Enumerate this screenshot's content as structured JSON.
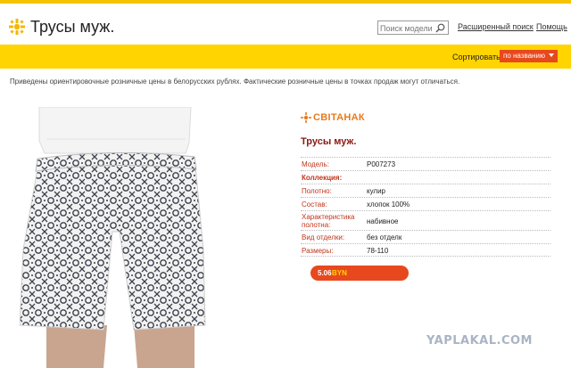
{
  "header": {
    "title": "Трусы муж.",
    "search_placeholder": "Поиск модели",
    "advanced_search_label": "Расширенный поиск",
    "help_label": "Помощь"
  },
  "sortbar": {
    "label": "Сортировать",
    "selected": "по названию"
  },
  "notice": "Приведены ориентировочные розничные цены в белорусских рублях. Фактические розничные цены в точках продаж могут отличаться.",
  "product": {
    "brand": "СВІТАНАК",
    "name": "Трусы муж.",
    "specs": [
      {
        "label": "Модель:",
        "value": "Р007273"
      },
      {
        "label": "Коллекция:",
        "value": ""
      },
      {
        "label": "Полотно:",
        "value": "кулир"
      },
      {
        "label": "Состав:",
        "value": "хлопок 100%"
      },
      {
        "label": "Характеристика полотна:",
        "value": "набивное"
      },
      {
        "label": "Вид отделки:",
        "value": "без отделк"
      },
      {
        "label": "Размеры:",
        "value": "78-110"
      }
    ],
    "price": {
      "value": "5.06",
      "currency": "BYN"
    }
  },
  "watermark": "YAPLAKAL.COM",
  "colors": {
    "accent_yellow": "#ffd400",
    "accent_orange": "#e8481d",
    "label_red": "#c0361b",
    "title_dark_red": "#8b1a12",
    "brand_orange": "#e77a1b"
  }
}
